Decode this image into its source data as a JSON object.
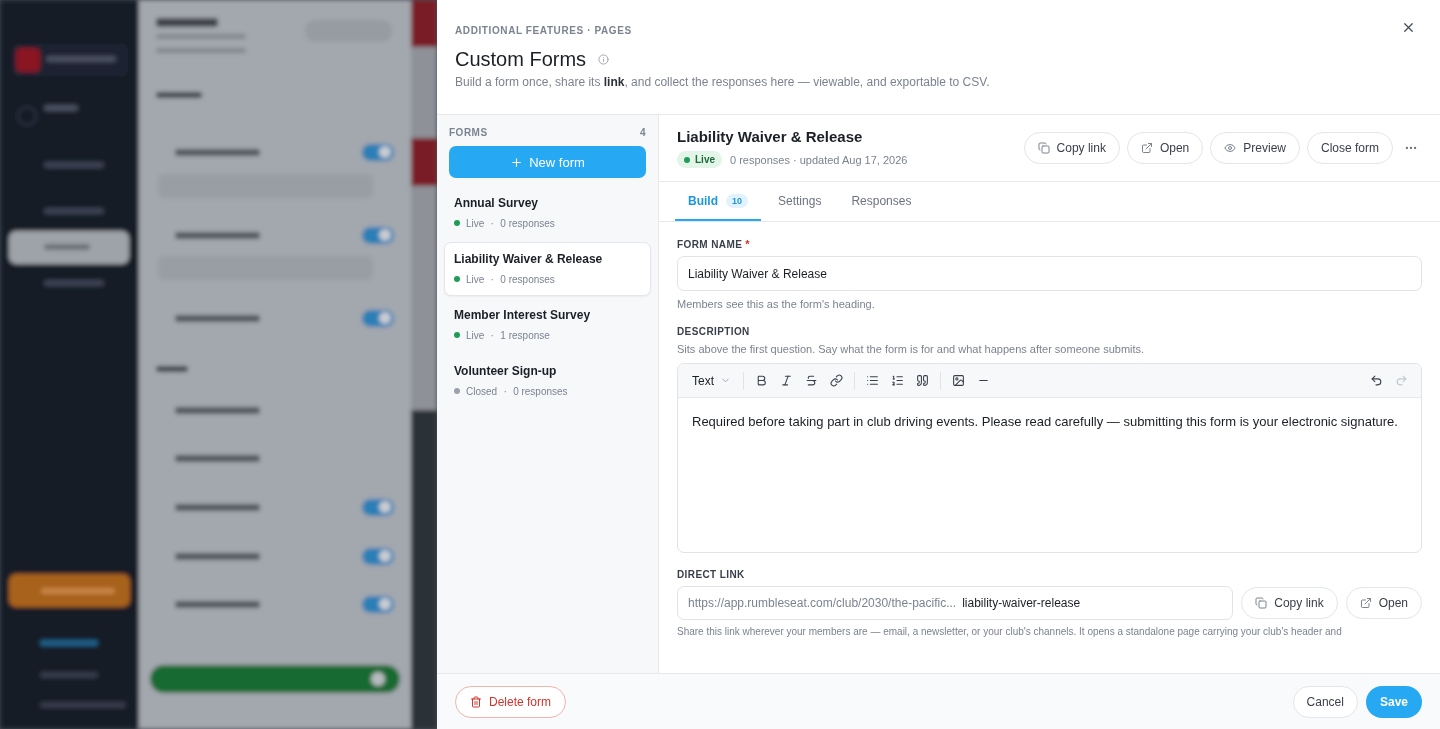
{
  "modal": {
    "breadcrumb": "ADDITIONAL FEATURES · PAGES",
    "title": "Custom Forms",
    "description": "Build a form once, share its **link**, and collect the responses here — viewable, and exportable to CSV.",
    "forms": {
      "heading": "FORMS",
      "count": "4",
      "new_button": "New form",
      "items": [
        {
          "title": "Annual Survey",
          "status": "Live",
          "color": "#1f9d55",
          "separator": "·",
          "responses": "0 responses",
          "selected": false
        },
        {
          "title": "Liability Waiver & Release",
          "status": "Live",
          "color": "#1f9d55",
          "separator": "·",
          "responses": "0 responses",
          "selected": true
        },
        {
          "title": "Member Interest Survey",
          "status": "Live",
          "color": "#1f9d55",
          "separator": "·",
          "responses": "1 response",
          "selected": false
        },
        {
          "title": "Volunteer Sign-up",
          "status": "Closed",
          "color": "#9aa1ab",
          "separator": "·",
          "responses": "0 responses",
          "selected": false
        }
      ]
    },
    "detail": {
      "title": "Liability Waiver & Release",
      "status": "Live",
      "meta": "0 responses · updated Aug 17, 2026",
      "actions": [
        {
          "label": "Copy link"
        },
        {
          "label": "Open"
        },
        {
          "label": "Preview"
        },
        {
          "label": "Close form"
        }
      ],
      "tabs": [
        {
          "label": "Build",
          "badge": "10",
          "selected": true
        },
        {
          "label": "Settings",
          "selected": false
        },
        {
          "label": "Responses",
          "selected": false
        }
      ],
      "form_name": {
        "label": "FORM NAME",
        "required_mark": "*",
        "value": "Liability Waiver & Release",
        "help": "Members see this as the form's heading."
      },
      "description": {
        "label": "DESCRIPTION",
        "help": "Sits above the first question. Say what the form is for and what happens after someone submits.",
        "block_type": "Text",
        "undo_enabled": true,
        "redo_enabled": false,
        "content": "Required before taking part in club driving events. Please read carefully — submitting this form is your electronic signature."
      },
      "direct_link": {
        "label": "DIRECT LINK",
        "prefix": "https://app.rumbleseat.com/club/2030/the-pacific...",
        "slug": "liability-waiver-release",
        "copy": "Copy link",
        "open": "Open",
        "help": "Share this link wherever your members are — email, a newsletter, or your club's channels. It opens a standalone page carrying your club's header and"
      }
    },
    "footer": {
      "delete": "Delete form",
      "cancel": "Cancel",
      "save": "Save"
    }
  }
}
